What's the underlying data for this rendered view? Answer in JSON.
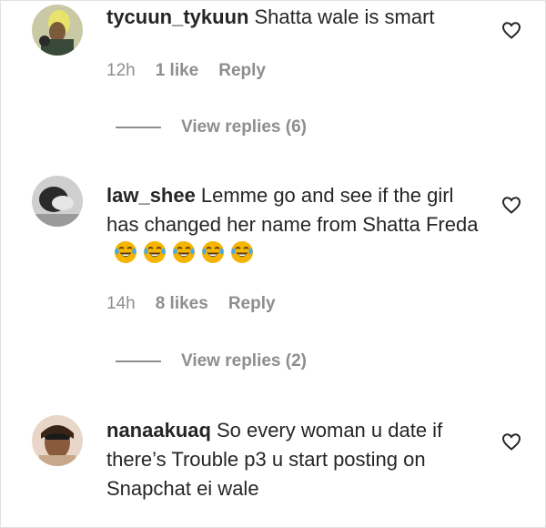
{
  "comments": [
    {
      "username": "tycuun_tykuun",
      "text": "Shatta wale is smart",
      "time": "12h",
      "likes": "1 like",
      "reply_label": "Reply",
      "view_replies": "View replies (6)",
      "emoji_count": 0
    },
    {
      "username": "law_shee",
      "text": "Lemme go and see if the girl has changed her name from Shatta Freda",
      "time": "14h",
      "likes": "8 likes",
      "reply_label": "Reply",
      "view_replies": "View replies (2)",
      "emoji_count": 5
    },
    {
      "username": "nanaakuaq",
      "text": "So every woman u date if there’s Trouble p3 u start posting on Snapchat ei wale",
      "emoji_count": 0
    }
  ],
  "icons": {
    "like": "heart-icon",
    "emoji": "face-with-tears-of-joy-emoji"
  },
  "colors": {
    "text": "#262626",
    "meta": "#8e8e8e",
    "emoji": "#f4b400"
  }
}
